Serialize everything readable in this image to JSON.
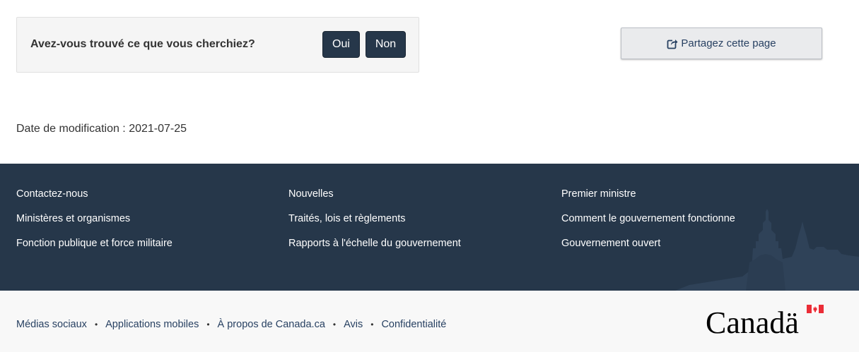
{
  "feedback": {
    "question": "Avez-vous trouvé ce que vous cherchiez?",
    "yes_label": "Oui",
    "no_label": "Non"
  },
  "share": {
    "label": "Partagez cette page",
    "icon": "share-icon"
  },
  "date_modified": "Date de modification : 2021-07-25",
  "footer": {
    "columns": [
      [
        "Contactez-nous",
        "Ministères et organismes",
        "Fonction publique et force militaire"
      ],
      [
        "Nouvelles",
        "Traités, lois et règlements",
        "Rapports à l'échelle du gouvernement"
      ],
      [
        "Premier ministre",
        "Comment le gouvernement fonctionne",
        "Gouvernement ouvert"
      ]
    ],
    "sub_links": [
      "Médias sociaux",
      "Applications mobiles",
      "À propos de Canada.ca",
      "Avis",
      "Confidentialité"
    ],
    "separator": "•",
    "wordmark": "Canadä"
  },
  "colors": {
    "dark_blue": "#26374a",
    "link_blue": "#284162",
    "flag_red": "#eb2d37"
  }
}
